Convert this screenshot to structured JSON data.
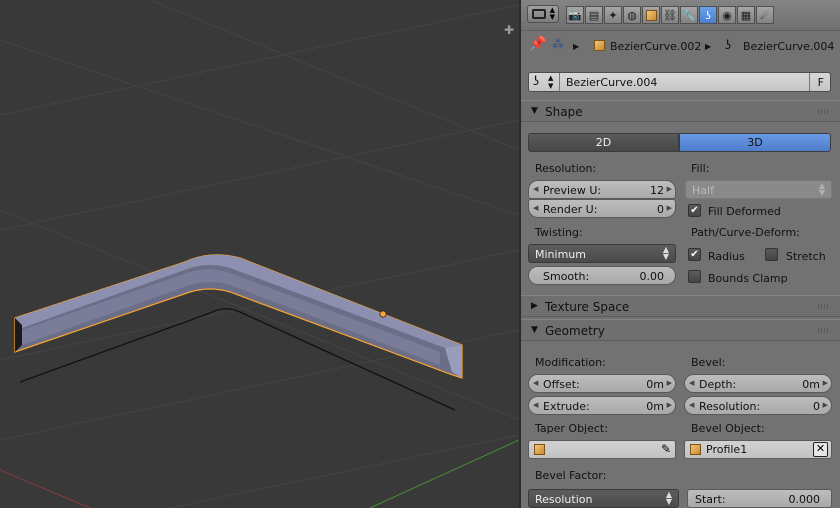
{
  "header": {
    "tabs": [
      "render",
      "render-layers",
      "scene",
      "world",
      "object",
      "constraints",
      "modifiers",
      "curve-data",
      "material",
      "texture",
      "physics"
    ],
    "active_tab": "curve-data"
  },
  "breadcrumb": {
    "object": "BezierCurve.002",
    "data": "BezierCurve.004"
  },
  "datablock": {
    "name": "BezierCurve.004",
    "fake_user": "F"
  },
  "shape": {
    "title": "Shape",
    "dim2d": "2D",
    "dim3d": "3D",
    "active_dim": "3D",
    "resolution_label": "Resolution:",
    "preview_u_label": "Preview U:",
    "preview_u": "12",
    "render_u_label": "Render U:",
    "render_u": "0",
    "fill_label": "Fill:",
    "fill_value": "Half",
    "fill_deformed": "Fill Deformed",
    "twisting_label": "Twisting:",
    "twisting_value": "Minimum",
    "smooth_label": "Smooth:",
    "smooth_value": "0.00",
    "path_label": "Path/Curve-Deform:",
    "radius": "Radius",
    "stretch": "Stretch",
    "bounds_clamp": "Bounds Clamp"
  },
  "texture_space": {
    "title": "Texture Space"
  },
  "geometry": {
    "title": "Geometry",
    "modification_label": "Modification:",
    "offset_label": "Offset:",
    "offset_value": "0m",
    "extrude_label": "Extrude:",
    "extrude_value": "0m",
    "bevel_label": "Bevel:",
    "depth_label": "Depth:",
    "depth_value": "0m",
    "resolution_label": "Resolution:",
    "resolution_value": "0",
    "taper_label": "Taper Object:",
    "bevel_object_label": "Bevel Object:",
    "bevel_object_value": "Profile1",
    "bevel_factor_label": "Bevel Factor:",
    "bevel_factor_mode": "Resolution",
    "start_label": "Start:",
    "start_value": "0.000"
  },
  "colors": {
    "viewport_bg": "#393939",
    "panel_bg": "#727272",
    "active_blue": "#5680c2",
    "selection_orange": "#f7a531"
  }
}
